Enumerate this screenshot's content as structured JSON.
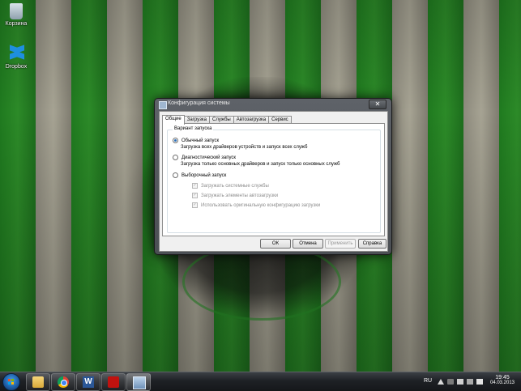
{
  "desktop": {
    "icons": [
      {
        "label": "Корзина",
        "icon": "recycle-bin-icon"
      },
      {
        "label": "Dropbox",
        "icon": "dropbox-icon"
      }
    ]
  },
  "dialog": {
    "title": "Конфигурация системы",
    "close_label": "✕",
    "tabs": [
      {
        "label": "Общие",
        "active": true
      },
      {
        "label": "Загрузка",
        "active": false
      },
      {
        "label": "Службы",
        "active": false
      },
      {
        "label": "Автозагрузка",
        "active": false
      },
      {
        "label": "Сервис",
        "active": false
      }
    ],
    "group_title": "Вариант запуска",
    "options": [
      {
        "label": "Обычный запуск",
        "description": "Загрузка всех драйверов устройств и запуск всех служб",
        "selected": true
      },
      {
        "label": "Диагностический запуск",
        "description": "Загрузка только основных драйверов и запуск только основных служб",
        "selected": false
      },
      {
        "label": "Выборочный запуск",
        "selected": false
      }
    ],
    "selective_checks": [
      {
        "label": "Загружать системные службы",
        "checked": true,
        "enabled": false
      },
      {
        "label": "Загружать элементы автозагрузки",
        "checked": true,
        "enabled": false
      },
      {
        "label": "Использовать оригинальную конфигурацию загрузки",
        "checked": true,
        "enabled": false
      }
    ],
    "buttons": {
      "ok": "ОК",
      "cancel": "Отмена",
      "apply": "Применить",
      "help": "Справка"
    }
  },
  "taskbar": {
    "pinned": [
      "explorer-icon",
      "chrome-icon",
      "word-icon",
      "acrobat-icon",
      "msconfig-icon"
    ],
    "language": "RU",
    "time": "19:45",
    "date": "04.03.2013"
  },
  "colors": {
    "wallpaper_green": "#2c8a28",
    "wallpaper_stone": "#a6a393",
    "dialog_frame": "#4b4f54",
    "taskbar": "#1e2125"
  }
}
